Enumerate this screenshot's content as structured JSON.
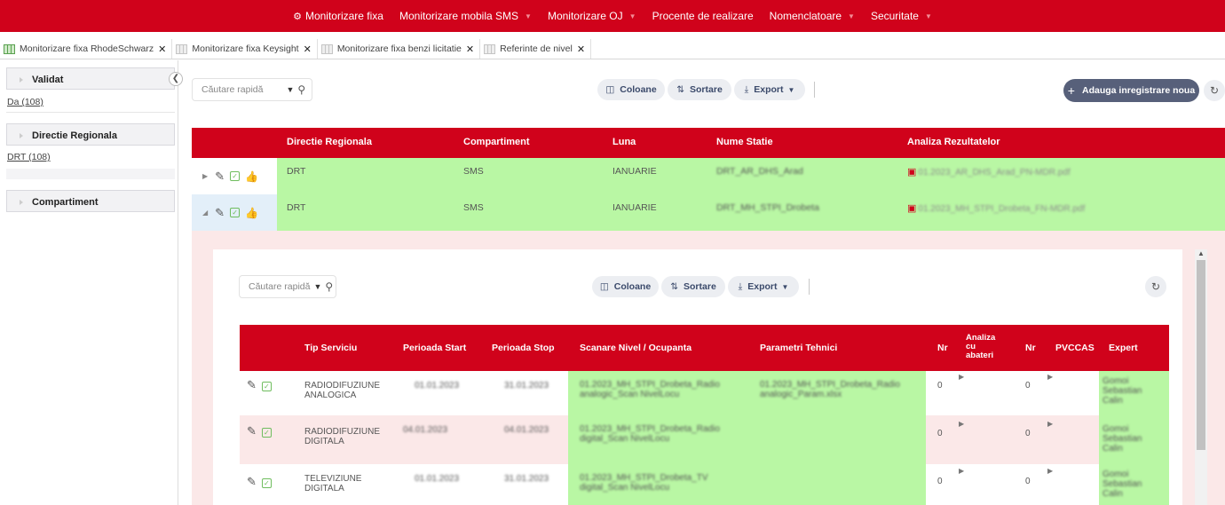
{
  "nav": {
    "items": [
      {
        "label": "Monitorizare fixa",
        "gear": true,
        "caret": false
      },
      {
        "label": "Monitorizare mobila SMS",
        "caret": true
      },
      {
        "label": "Monitorizare OJ",
        "caret": true
      },
      {
        "label": "Procente de realizare",
        "caret": false
      },
      {
        "label": "Nomenclatoare",
        "caret": true
      },
      {
        "label": "Securitate",
        "caret": true
      }
    ]
  },
  "tabs": [
    {
      "label": "Monitorizare fixa RhodeSchwarz",
      "active": true
    },
    {
      "label": "Monitorizare fixa Keysight",
      "active": false
    },
    {
      "label": "Monitorizare fixa benzi licitatie",
      "active": false
    },
    {
      "label": "Referinte de nivel",
      "active": false
    }
  ],
  "sidebar": {
    "facets": [
      {
        "title": "Validat",
        "value": "Da (108)"
      },
      {
        "title": "Directie Regionala",
        "value": "DRT (108)"
      },
      {
        "title": "Compartiment",
        "value": ""
      }
    ]
  },
  "toolbar": {
    "search_placeholder": "Căutare rapidă",
    "columns_label": "Coloane",
    "sort_label": "Sortare",
    "export_label": "Export",
    "add_label": "Adauga inregistrare noua"
  },
  "outer_table": {
    "headers": [
      "Directie Regionala",
      "Compartiment",
      "Luna",
      "Nume Statie",
      "Analiza Rezultatelor"
    ],
    "rows": [
      {
        "directie": "DRT",
        "compartiment": "SMS",
        "luna": "IANUARIE",
        "statie": "DRT_AR_DHS_Arad",
        "analiza": "01.2023_AR_DHS_Arad_PN-MDR.pdf"
      },
      {
        "directie": "DRT",
        "compartiment": "SMS",
        "luna": "IANUARIE",
        "statie": "DRT_MH_STPI_Drobeta",
        "analiza": "01.2023_MH_STPI_Drobeta_FN-MDR.pdf"
      }
    ]
  },
  "inner": {
    "search_placeholder": "Căutare rapidă",
    "columns_label": "Coloane",
    "sort_label": "Sortare",
    "export_label": "Export",
    "headers": {
      "tip": "Tip Serviciu",
      "start": "Perioada Start",
      "stop": "Perioada Stop",
      "scanare": "Scanare Nivel / Ocupanta",
      "param": "Parametri Tehnici",
      "nr1": "Nr",
      "analiza": "Analiza cu abateri",
      "nr2": "Nr",
      "pvccas": "PVCCAS",
      "expert": "Expert"
    },
    "rows": [
      {
        "tip": "RADIODIFUZIUNE ANALOGICA",
        "start": "01.01.2023",
        "stop": "31.01.2023",
        "scanare": "01.2023_MH_STPI_Drobeta_Radio analogic_Scan NivelLocu",
        "param": "01.2023_MH_STPI_Drobeta_Radio analogic_Param.xlsx",
        "nr1": "0",
        "nr2": "0",
        "expert": "Gomoi Sebastian Calin"
      },
      {
        "tip": "RADIODIFUZIUNE DIGITALA",
        "start": "04.01.2023",
        "stop": "04.01.2023",
        "scanare": "01.2023_MH_STPI_Drobeta_Radio digital_Scan NivelLocu",
        "param": "",
        "nr1": "0",
        "nr2": "0",
        "expert": "Gomoi Sebastian Calin"
      },
      {
        "tip": "TELEVIZIUNE DIGITALA",
        "start": "01.01.2023",
        "stop": "31.01.2023",
        "scanare": "01.2023_MH_STPI_Drobeta_TV digital_Scan NivelLocu",
        "param": "",
        "nr1": "0",
        "nr2": "0",
        "expert": "Gomoi Sebastian Calin"
      }
    ]
  }
}
